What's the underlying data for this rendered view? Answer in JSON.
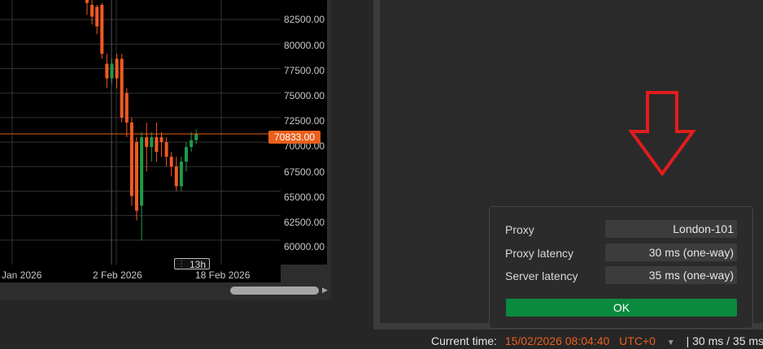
{
  "chart": {
    "price_ticks": [
      "82500.00",
      "80000.00",
      "77500.00",
      "75000.00",
      "72500.00",
      "70000.00",
      "67500.00",
      "65000.00",
      "62500.00",
      "60000.00"
    ],
    "time_labels": [
      "Jan 2026",
      "2 Feb 2026",
      "18 Feb 2026"
    ],
    "crosshair_time": "13h",
    "current_price": "70833.00",
    "colors": {
      "up": "#1f9a4a",
      "down": "#f05a24",
      "price_line": "#e8601c",
      "grid": "#333333"
    },
    "chart_data": {
      "type": "candlestick",
      "ylim": [
        57500,
        84500
      ],
      "candles": [
        {
          "o": 84800,
          "h": 85000,
          "l": 83000,
          "c": 84200
        },
        {
          "o": 84000,
          "h": 84500,
          "l": 82000,
          "c": 82800
        },
        {
          "o": 83800,
          "h": 84000,
          "l": 81000,
          "c": 81800
        },
        {
          "o": 84000,
          "h": 84200,
          "l": 78500,
          "c": 79000
        },
        {
          "o": 78000,
          "h": 79000,
          "l": 75500,
          "c": 76500
        },
        {
          "o": 76500,
          "h": 78500,
          "l": 76000,
          "c": 78000
        },
        {
          "o": 78500,
          "h": 79000,
          "l": 75500,
          "c": 76500
        },
        {
          "o": 78500,
          "h": 79000,
          "l": 72000,
          "c": 72500
        },
        {
          "o": 75000,
          "h": 75500,
          "l": 70500,
          "c": 72000
        },
        {
          "o": 72000,
          "h": 72500,
          "l": 63500,
          "c": 64500
        },
        {
          "o": 70000,
          "h": 70500,
          "l": 62000,
          "c": 63000
        },
        {
          "o": 63500,
          "h": 71000,
          "l": 60000,
          "c": 70500
        },
        {
          "o": 70500,
          "h": 72000,
          "l": 67000,
          "c": 69500
        },
        {
          "o": 69500,
          "h": 71000,
          "l": 68000,
          "c": 70500
        },
        {
          "o": 70500,
          "h": 72000,
          "l": 68000,
          "c": 69000
        },
        {
          "o": 70500,
          "h": 71000,
          "l": 68500,
          "c": 70000
        },
        {
          "o": 70000,
          "h": 70500,
          "l": 67500,
          "c": 68500
        },
        {
          "o": 68500,
          "h": 69000,
          "l": 66500,
          "c": 67500
        },
        {
          "o": 67500,
          "h": 68500,
          "l": 65000,
          "c": 65500
        },
        {
          "o": 65500,
          "h": 68500,
          "l": 65000,
          "c": 68000
        },
        {
          "o": 68000,
          "h": 70000,
          "l": 67000,
          "c": 69500
        },
        {
          "o": 69500,
          "h": 71000,
          "l": 69000,
          "c": 70200
        },
        {
          "o": 70200,
          "h": 71300,
          "l": 69800,
          "c": 70833
        }
      ]
    }
  },
  "popup": {
    "rows": [
      {
        "label": "Proxy",
        "value": "London-101"
      },
      {
        "label": "Proxy latency",
        "value": "30 ms (one-way)"
      },
      {
        "label": "Server latency",
        "value": "35 ms (one-way)"
      }
    ],
    "ok_label": "OK"
  },
  "status_bar": {
    "label": "Current time:",
    "time": "15/02/2026 08:04:40",
    "timezone": "UTC+0",
    "dropdown_icon": "▼",
    "latency": "| 30 ms / 35 ms"
  }
}
